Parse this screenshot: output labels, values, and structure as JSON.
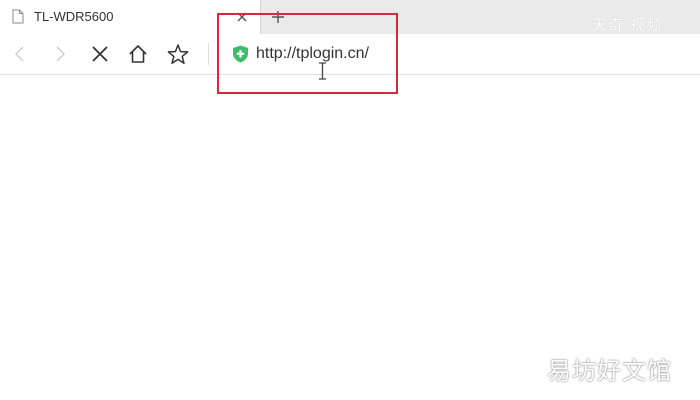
{
  "tab": {
    "title": "TL-WDR5600",
    "close_icon": "close-icon",
    "page_icon": "page-icon"
  },
  "new_tab": {
    "icon": "plus-icon"
  },
  "navbar": {
    "back_icon": "chevron-left-icon",
    "forward_icon": "chevron-right-icon",
    "stop_icon": "close-icon",
    "home_icon": "home-icon",
    "bookmark_icon": "star-icon",
    "security_icon": "shield-plus-icon"
  },
  "address_bar": {
    "url": "http://tplogin.cn/"
  },
  "highlight": {
    "color": "#d62a3a"
  },
  "watermarks": {
    "top": "天奇·视频",
    "bottom": "易坊好文馆"
  },
  "colors": {
    "security_green": "#3dbd6a",
    "tabbar_bg": "#eaeaea"
  }
}
